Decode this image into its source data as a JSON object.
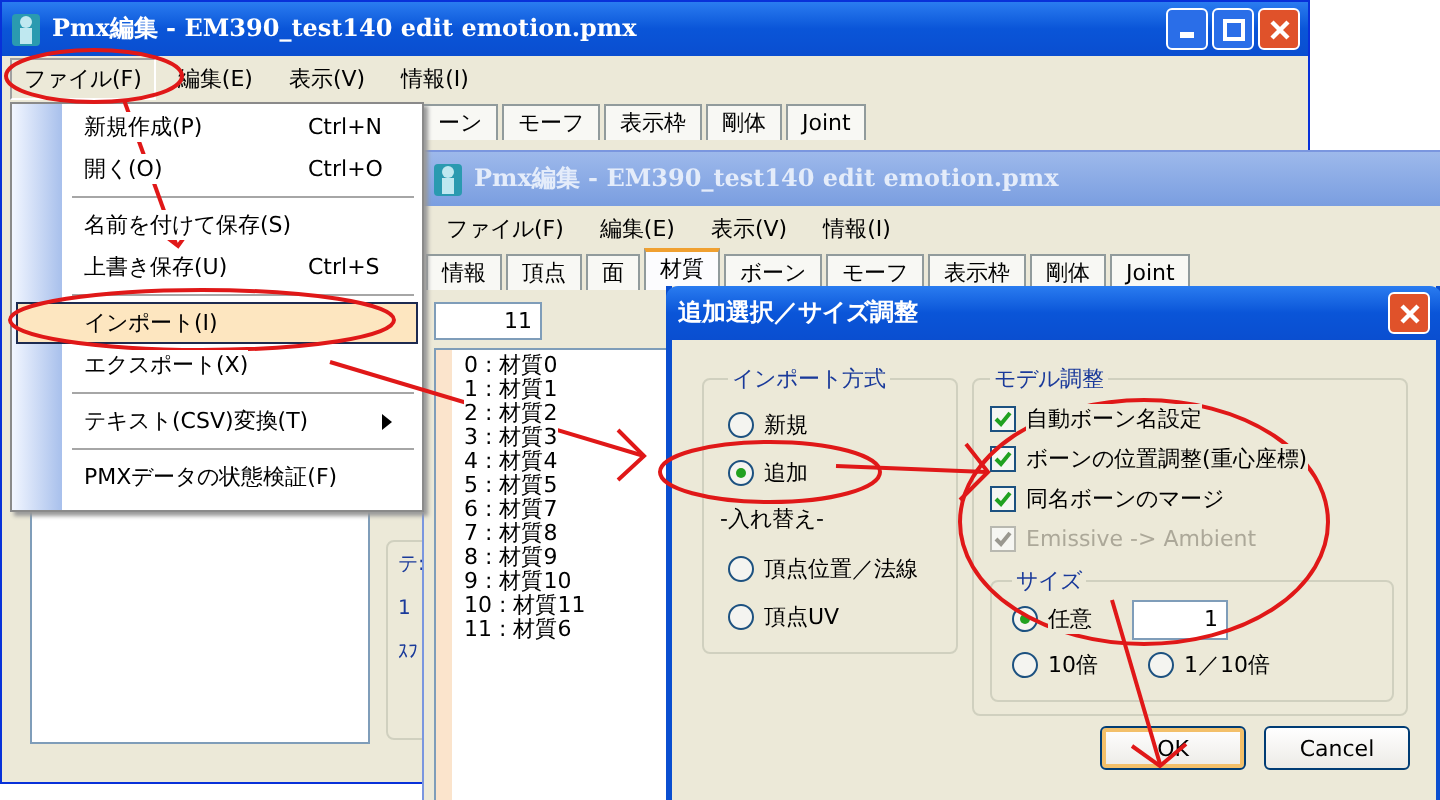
{
  "back_window": {
    "title": "Pmx編集 - EM390_test140 edit emotion.pmx",
    "menu": [
      {
        "label": "ファイル(F)",
        "selected": true
      },
      {
        "label": "編集(E)",
        "selected": false
      },
      {
        "label": "表示(V)",
        "selected": false
      },
      {
        "label": "情報(I)",
        "selected": false
      }
    ],
    "tabs": [
      "ーン",
      "モーフ",
      "表示枠",
      "剛体",
      "Joint"
    ],
    "panel_labels": [
      "テ:",
      "1",
      "ｽﾌ"
    ]
  },
  "file_menu": {
    "items": [
      {
        "kind": "item",
        "label": "新規作成(P)",
        "shortcut": "Ctrl+N",
        "selected": false
      },
      {
        "kind": "item",
        "label": "開く(O)",
        "shortcut": "Ctrl+O",
        "selected": false
      },
      {
        "kind": "separator"
      },
      {
        "kind": "item",
        "label": "名前を付けて保存(S)",
        "selected": false
      },
      {
        "kind": "item",
        "label": "上書き保存(U)",
        "shortcut": "Ctrl+S",
        "selected": false
      },
      {
        "kind": "separator"
      },
      {
        "kind": "item",
        "label": "インポート(I)",
        "selected": true
      },
      {
        "kind": "item",
        "label": "エクスポート(X)",
        "selected": false
      },
      {
        "kind": "separator"
      },
      {
        "kind": "submenu",
        "label": "テキスト(CSV)変換(T)",
        "selected": false
      },
      {
        "kind": "separator"
      },
      {
        "kind": "item",
        "label": "PMXデータの状態検証(F)",
        "selected": false
      }
    ]
  },
  "front_window": {
    "title": "Pmx編集 - EM390_test140 edit emotion.pmx",
    "menu": [
      "ファイル(F)",
      "編集(E)",
      "表示(V)",
      "情報(I)"
    ],
    "tabs": [
      {
        "label": "情報",
        "selected": false
      },
      {
        "label": "頂点",
        "selected": false
      },
      {
        "label": "面",
        "selected": false
      },
      {
        "label": "材質",
        "selected": true
      },
      {
        "label": "ボーン",
        "selected": false
      },
      {
        "label": "モーフ",
        "selected": false
      },
      {
        "label": "表示枠",
        "selected": false
      },
      {
        "label": "剛体",
        "selected": false
      },
      {
        "label": "Joint",
        "selected": false
      }
    ],
    "count": "11",
    "materials": [
      "0 : 材質0",
      "1 : 材質1",
      "2 : 材質2",
      "3 : 材質3",
      "4 : 材質4",
      "5 : 材質5",
      "6 : 材質7",
      "7 : 材質8",
      "8 : 材質9",
      "9 : 材質10",
      "10 : 材質11",
      "11 : 材質6"
    ]
  },
  "dialog": {
    "title": "追加選択／サイズ調整",
    "import_group": {
      "title": "インポート方式",
      "options": [
        {
          "label": "新規",
          "selected": false
        },
        {
          "label": "追加",
          "selected": true
        }
      ],
      "replace_label": "-入れ替え-",
      "replace_options": [
        {
          "label": "頂点位置／法線",
          "selected": false
        },
        {
          "label": "頂点UV",
          "selected": false
        }
      ]
    },
    "model_group": {
      "title": "モデル調整",
      "checks": [
        {
          "label": "自動ボーン名設定",
          "checked": true,
          "disabled": false
        },
        {
          "label": "ボーンの位置調整(重心座標)",
          "checked": true,
          "disabled": false
        },
        {
          "label": "同名ボーンのマージ",
          "checked": true,
          "disabled": false
        },
        {
          "label": "Emissive -> Ambient",
          "checked": true,
          "disabled": true
        }
      ],
      "size_group": {
        "title": "サイズ",
        "value": "1",
        "options": [
          {
            "label": "任意",
            "selected": true
          },
          {
            "label": "10倍",
            "selected": false
          },
          {
            "label": "1／10倍",
            "selected": false
          }
        ]
      }
    },
    "buttons": [
      {
        "label": "OK",
        "default": true
      },
      {
        "label": "Cancel",
        "default": false
      }
    ]
  }
}
